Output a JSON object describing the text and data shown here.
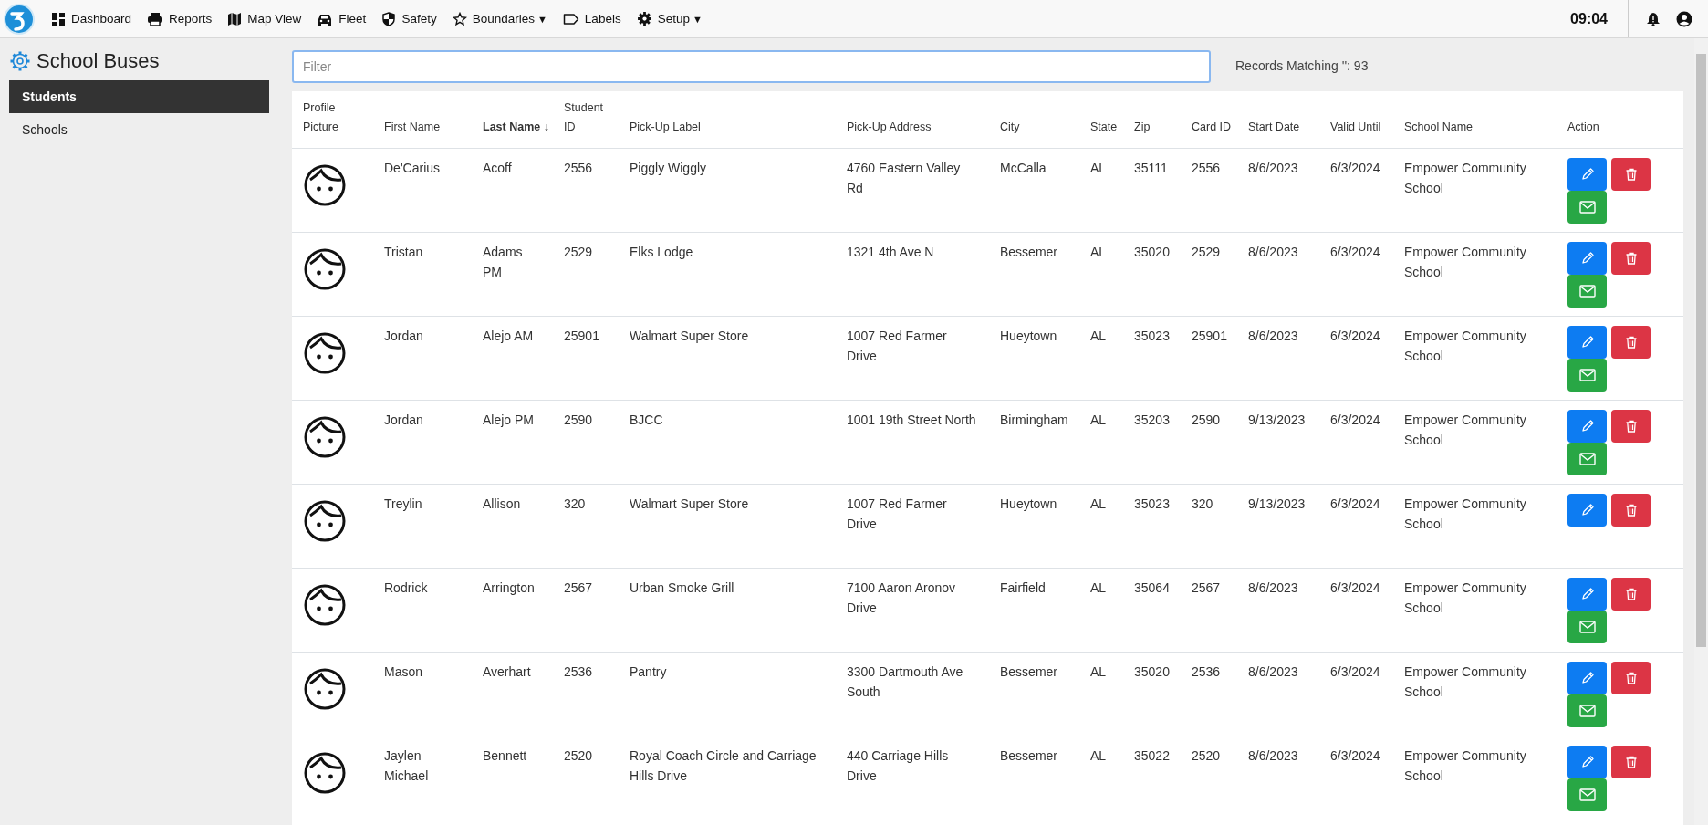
{
  "nav": {
    "items": [
      {
        "label": "Dashboard"
      },
      {
        "label": "Reports"
      },
      {
        "label": "Map View"
      },
      {
        "label": "Fleet"
      },
      {
        "label": "Safety"
      },
      {
        "label": "Boundaries",
        "caret": "▼"
      },
      {
        "label": "Labels"
      },
      {
        "label": "Setup",
        "caret": "▼"
      }
    ],
    "time": "09:04"
  },
  "sidebar": {
    "title": "School Buses",
    "items": [
      {
        "label": "Students",
        "selected": true
      },
      {
        "label": "Schools",
        "selected": false
      }
    ]
  },
  "filter": {
    "placeholder": "Filter"
  },
  "records_matching": "Records Matching '': 93",
  "table": {
    "columns": [
      {
        "label": "Profile Picture",
        "sorted": false
      },
      {
        "label": "First Name",
        "sorted": false
      },
      {
        "label": "Last Name ↓",
        "sorted": true
      },
      {
        "label": "Student ID",
        "sorted": false
      },
      {
        "label": "Pick-Up Label",
        "sorted": false
      },
      {
        "label": "Pick-Up Address",
        "sorted": false
      },
      {
        "label": "City",
        "sorted": false
      },
      {
        "label": "State",
        "sorted": false
      },
      {
        "label": "Zip",
        "sorted": false
      },
      {
        "label": "Card ID",
        "sorted": false
      },
      {
        "label": "Start Date",
        "sorted": false
      },
      {
        "label": "Valid Until",
        "sorted": false
      },
      {
        "label": "School Name",
        "sorted": false
      },
      {
        "label": "Action",
        "sorted": false
      }
    ],
    "rows": [
      {
        "cells": [
          "",
          "De'Carius",
          "Acoff",
          "2556",
          "Piggly Wiggly",
          "4760 Eastern Valley Rd",
          "McCalla",
          "AL",
          "35111",
          "2556",
          "8/6/2023",
          "6/3/2024",
          "Empower Community School"
        ],
        "can_email": true
      },
      {
        "cells": [
          "",
          "Tristan",
          "Adams PM",
          "2529",
          "Elks Lodge",
          "1321 4th Ave N",
          "Bessemer",
          "AL",
          "35020",
          "2529",
          "8/6/2023",
          "6/3/2024",
          "Empower Community School"
        ],
        "can_email": true
      },
      {
        "cells": [
          "",
          "Jordan",
          "Alejo AM",
          "25901",
          "Walmart Super Store",
          "1007 Red Farmer Drive",
          "Hueytown",
          "AL",
          "35023",
          "25901",
          "8/6/2023",
          "6/3/2024",
          "Empower Community School"
        ],
        "can_email": true
      },
      {
        "cells": [
          "",
          "Jordan",
          "Alejo PM",
          "2590",
          "BJCC",
          "1001 19th Street North",
          "Birmingham",
          "AL",
          "35203",
          "2590",
          "9/13/2023",
          "6/3/2024",
          "Empower Community School"
        ],
        "can_email": true
      },
      {
        "cells": [
          "",
          "Treylin",
          "Allison",
          "320",
          "Walmart Super Store",
          "1007 Red Farmer Drive",
          "Hueytown",
          "AL",
          "35023",
          "320",
          "9/13/2023",
          "6/3/2024",
          "Empower Community School"
        ],
        "can_email": false
      },
      {
        "cells": [
          "",
          "Rodrick",
          "Arrington",
          "2567",
          "Urban Smoke Grill",
          "7100 Aaron Aronov Drive",
          "Fairfield",
          "AL",
          "35064",
          "2567",
          "8/6/2023",
          "6/3/2024",
          "Empower Community School"
        ],
        "can_email": true
      },
      {
        "cells": [
          "",
          "Mason",
          "Averhart",
          "2536",
          "Pantry",
          "3300 Dartmouth Ave South",
          "Bessemer",
          "AL",
          "35020",
          "2536",
          "8/6/2023",
          "6/3/2024",
          "Empower Community School"
        ],
        "can_email": true
      },
      {
        "cells": [
          "",
          "Jaylen Michael",
          "Bennett",
          "2520",
          "Royal Coach Circle and Carriage Hills Drive",
          "440 Carriage Hills Drive",
          "Bessemer",
          "AL",
          "35022",
          "2520",
          "8/6/2023",
          "6/3/2024",
          "Empower Community School"
        ],
        "can_email": true
      }
    ]
  }
}
